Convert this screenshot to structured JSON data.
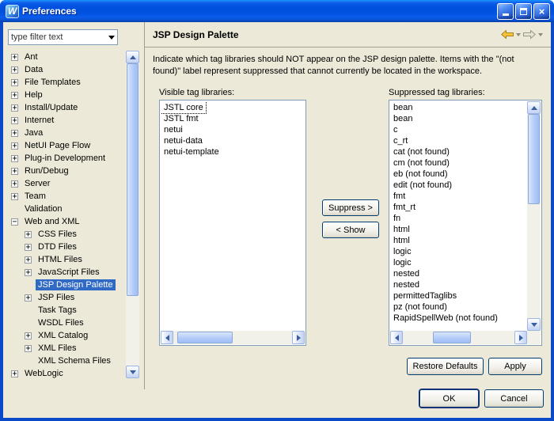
{
  "window": {
    "title": "Preferences",
    "logo_letter": "W",
    "icons": {
      "close_glyph": "×"
    }
  },
  "sidebar": {
    "filter_text": "type filter text",
    "tree": [
      {
        "label": "Ant",
        "exp": "+",
        "level": 0
      },
      {
        "label": "Data",
        "exp": "+",
        "level": 0
      },
      {
        "label": "File Templates",
        "exp": "+",
        "level": 0
      },
      {
        "label": "Help",
        "exp": "+",
        "level": 0
      },
      {
        "label": "Install/Update",
        "exp": "+",
        "level": 0
      },
      {
        "label": "Internet",
        "exp": "+",
        "level": 0
      },
      {
        "label": "Java",
        "exp": "+",
        "level": 0
      },
      {
        "label": "NetUI Page Flow",
        "exp": "+",
        "level": 0
      },
      {
        "label": "Plug-in Development",
        "exp": "+",
        "level": 0
      },
      {
        "label": "Run/Debug",
        "exp": "+",
        "level": 0
      },
      {
        "label": "Server",
        "exp": "+",
        "level": 0
      },
      {
        "label": "Team",
        "exp": "+",
        "level": 0
      },
      {
        "label": "Validation",
        "exp": "",
        "level": 0
      },
      {
        "label": "Web and XML",
        "exp": "-",
        "level": 0
      },
      {
        "label": "CSS Files",
        "exp": "+",
        "level": 1
      },
      {
        "label": "DTD Files",
        "exp": "+",
        "level": 1
      },
      {
        "label": "HTML Files",
        "exp": "+",
        "level": 1
      },
      {
        "label": "JavaScript Files",
        "exp": "+",
        "level": 1
      },
      {
        "label": "JSP Design Palette",
        "exp": "",
        "level": 1,
        "selected": true
      },
      {
        "label": "JSP Files",
        "exp": "+",
        "level": 1
      },
      {
        "label": "Task Tags",
        "exp": "",
        "level": 1
      },
      {
        "label": "WSDL Files",
        "exp": "",
        "level": 1
      },
      {
        "label": "XML Catalog",
        "exp": "+",
        "level": 1
      },
      {
        "label": "XML Files",
        "exp": "+",
        "level": 1
      },
      {
        "label": "XML Schema Files",
        "exp": "",
        "level": 1
      },
      {
        "label": "WebLogic",
        "exp": "+",
        "level": 0
      }
    ]
  },
  "main": {
    "title": "JSP Design Palette",
    "description": "Indicate which tag libraries should NOT appear on the JSP design palette. Items with the \"(not found)\" label represent suppressed that cannot currently be located in the workspace.",
    "visible_label": "Visible tag libraries:",
    "visible_items": [
      "JSTL core",
      "JSTL fmt",
      "netui",
      "netui-data",
      "netui-template"
    ],
    "suppressed_label": "Suppressed tag libraries:",
    "suppressed_items": [
      "bean",
      "bean",
      "c",
      "c_rt",
      "cat (not found)",
      "cm (not found)",
      "eb (not found)",
      "edit (not found)",
      "fmt",
      "fmt_rt",
      "fn",
      "html",
      "html",
      "logic",
      "logic",
      "nested",
      "nested",
      "permittedTaglibs",
      "pz (not found)",
      "RapidSpellWeb (not found)"
    ],
    "buttons": {
      "suppress": "Suppress >",
      "show": "< Show",
      "restore_defaults": "Restore Defaults",
      "apply": "Apply"
    }
  },
  "footer": {
    "ok": "OK",
    "cancel": "Cancel"
  }
}
